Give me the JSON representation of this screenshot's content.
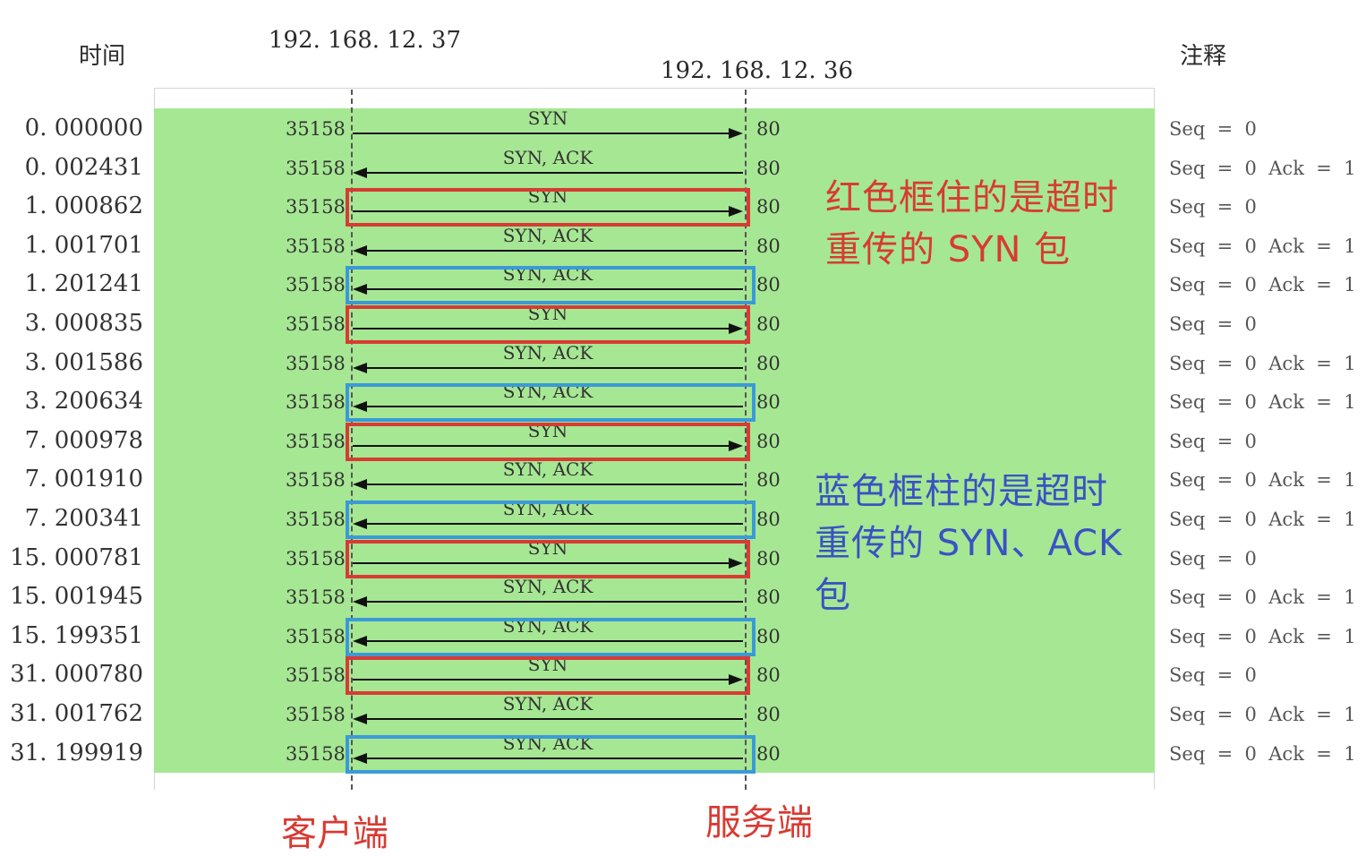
{
  "headers": {
    "time": "时间",
    "client_ip": "192. 168. 12. 37",
    "server_ip": "192. 168. 12. 36",
    "notes": "注释"
  },
  "colors": {
    "panel": "#a6e793",
    "red_box": "#d83b33",
    "blue_box": "#3a9ad8",
    "red_text": "#d83b33",
    "blue_text": "#3a52c4"
  },
  "rows": [
    {
      "time": "0. 000000",
      "client_port": "35158",
      "flag": "SYN",
      "dir": "right",
      "server_port": "80",
      "note": "Seq  =  0",
      "box": "none"
    },
    {
      "time": "0. 002431",
      "client_port": "35158",
      "flag": "SYN,  ACK",
      "dir": "left",
      "server_port": "80",
      "note": "Seq  =  0  Ack  =  1",
      "box": "none"
    },
    {
      "time": "1. 000862",
      "client_port": "35158",
      "flag": "SYN",
      "dir": "right",
      "server_port": "80",
      "note": "Seq  =  0",
      "box": "red"
    },
    {
      "time": "1. 001701",
      "client_port": "35158",
      "flag": "SYN,  ACK",
      "dir": "left",
      "server_port": "80",
      "note": "Seq  =  0  Ack  =  1",
      "box": "none"
    },
    {
      "time": "1. 201241",
      "client_port": "35158",
      "flag": "SYN,  ACK",
      "dir": "left",
      "server_port": "80",
      "note": "Seq  =  0  Ack  =  1",
      "box": "blue"
    },
    {
      "time": "3. 000835",
      "client_port": "35158",
      "flag": "SYN",
      "dir": "right",
      "server_port": "80",
      "note": "Seq  =  0",
      "box": "red"
    },
    {
      "time": "3. 001586",
      "client_port": "35158",
      "flag": "SYN,  ACK",
      "dir": "left",
      "server_port": "80",
      "note": "Seq  =  0  Ack  =  1",
      "box": "none"
    },
    {
      "time": "3. 200634",
      "client_port": "35158",
      "flag": "SYN,  ACK",
      "dir": "left",
      "server_port": "80",
      "note": "Seq  =  0  Ack  =  1",
      "box": "blue"
    },
    {
      "time": "7. 000978",
      "client_port": "35158",
      "flag": "SYN",
      "dir": "right",
      "server_port": "80",
      "note": "Seq  =  0",
      "box": "red"
    },
    {
      "time": "7. 001910",
      "client_port": "35158",
      "flag": "SYN,  ACK",
      "dir": "left",
      "server_port": "80",
      "note": "Seq  =  0  Ack  =  1",
      "box": "none"
    },
    {
      "time": "7. 200341",
      "client_port": "35158",
      "flag": "SYN,  ACK",
      "dir": "left",
      "server_port": "80",
      "note": "Seq  =  0  Ack  =  1",
      "box": "blue"
    },
    {
      "time": "15. 000781",
      "client_port": "35158",
      "flag": "SYN",
      "dir": "right",
      "server_port": "80",
      "note": "Seq  =  0",
      "box": "red"
    },
    {
      "time": "15. 001945",
      "client_port": "35158",
      "flag": "SYN,  ACK",
      "dir": "left",
      "server_port": "80",
      "note": "Seq  =  0  Ack  =  1",
      "box": "none"
    },
    {
      "time": "15. 199351",
      "client_port": "35158",
      "flag": "SYN,  ACK",
      "dir": "left",
      "server_port": "80",
      "note": "Seq  =  0  Ack  =  1",
      "box": "blue"
    },
    {
      "time": "31. 000780",
      "client_port": "35158",
      "flag": "SYN",
      "dir": "right",
      "server_port": "80",
      "note": "Seq  =  0",
      "box": "red"
    },
    {
      "time": "31. 001762",
      "client_port": "35158",
      "flag": "SYN,  ACK",
      "dir": "left",
      "server_port": "80",
      "note": "Seq  =  0  Ack  =  1",
      "box": "none"
    },
    {
      "time": "31. 199919",
      "client_port": "35158",
      "flag": "SYN,  ACK",
      "dir": "left",
      "server_port": "80",
      "note": "Seq  =  0  Ack  =  1",
      "box": "blue"
    }
  ],
  "annotations": {
    "red": "红色框住的是超时重传的 SYN 包",
    "blue": "蓝色框柱的是超时重传的 SYN、ACK 包"
  },
  "labels": {
    "client": "客户端",
    "server": "服务端"
  }
}
